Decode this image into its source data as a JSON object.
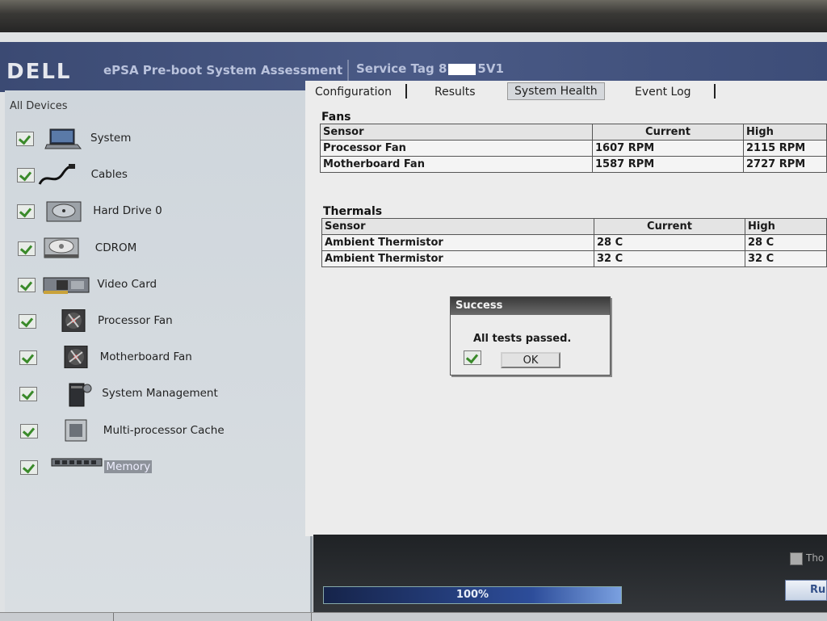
{
  "header": {
    "logo": "DELL",
    "title": "ePSA Pre-boot System Assessment",
    "service_tag_label": "Service Tag 8",
    "service_tag_suffix": "5V1"
  },
  "sidebar": {
    "title": "All Devices",
    "devices": [
      {
        "label": "System",
        "icon": "laptop-icon"
      },
      {
        "label": "Cables",
        "icon": "cable-icon"
      },
      {
        "label": "Hard Drive 0",
        "icon": "hard-drive-icon"
      },
      {
        "label": "CDROM",
        "icon": "cdrom-icon"
      },
      {
        "label": "Video Card",
        "icon": "video-card-icon"
      },
      {
        "label": "Processor Fan",
        "icon": "fan-icon"
      },
      {
        "label": "Motherboard Fan",
        "icon": "fan-icon"
      },
      {
        "label": "System Management",
        "icon": "system-management-icon"
      },
      {
        "label": "Multi-processor Cache",
        "icon": "cpu-icon"
      },
      {
        "label": "Memory",
        "icon": "memory-icon"
      }
    ]
  },
  "tabs": [
    "Configuration",
    "Results",
    "System Health",
    "Event Log"
  ],
  "fans": {
    "title": "Fans",
    "headers": [
      "Sensor",
      "Current",
      "High"
    ],
    "rows": [
      [
        "Processor Fan",
        "1607 RPM",
        "2115 RPM"
      ],
      [
        "Motherboard Fan",
        "1587 RPM",
        "2727 RPM"
      ]
    ]
  },
  "thermals": {
    "title": "Thermals",
    "headers": [
      "Sensor",
      "Current",
      "High"
    ],
    "rows": [
      [
        "Ambient Thermistor",
        "28 C",
        "28 C"
      ],
      [
        "Ambient Thermistor",
        "32 C",
        "32 C"
      ]
    ]
  },
  "dialog": {
    "title": "Success",
    "message": "All tests passed.",
    "ok_label": "OK"
  },
  "progress": {
    "text": "100%",
    "value": 1.0
  },
  "bottom": {
    "option_label": "Tho",
    "run_label": "Ru"
  },
  "colors": {
    "header": "#3b4a73",
    "check": "#3a8a2a",
    "progress": "#2d4d9a"
  }
}
